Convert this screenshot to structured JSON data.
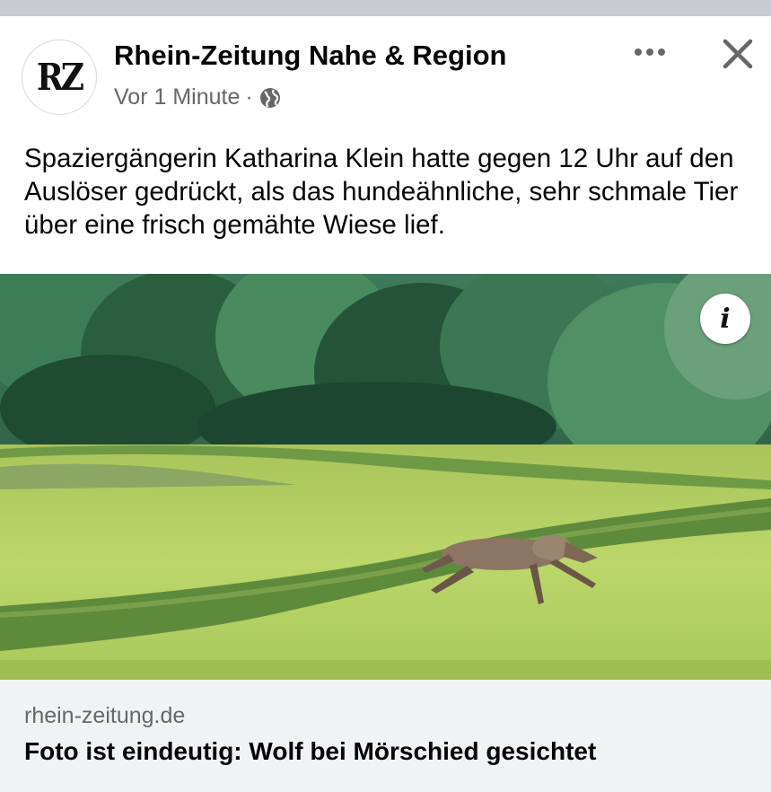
{
  "post": {
    "page_name": "Rhein-Zeitung Nahe & Region",
    "avatar_text": "RZ",
    "timestamp": "Vor 1 Minute",
    "separator": "·",
    "audience_icon": "globe-icon",
    "text": "Spaziergängerin Katharina Klein hatte gegen 12 Uhr auf den Auslöser gedrückt, als das hundeähnliche, sehr schmale Tier über eine frisch gemähte Wiese lief.",
    "more_icon": "more-horizontal-icon",
    "close_icon": "close-icon"
  },
  "photo": {
    "info_icon": "info-icon",
    "info_glyph": "i"
  },
  "link": {
    "domain": "rhein-zeitung.de",
    "title": "Foto ist eindeutig: Wolf bei Mörschied gesichtet"
  },
  "colors": {
    "text_primary": "#050505",
    "text_secondary": "#65676b",
    "link_bg": "#f0f2f5",
    "top_strip": "#c9ccd1"
  }
}
